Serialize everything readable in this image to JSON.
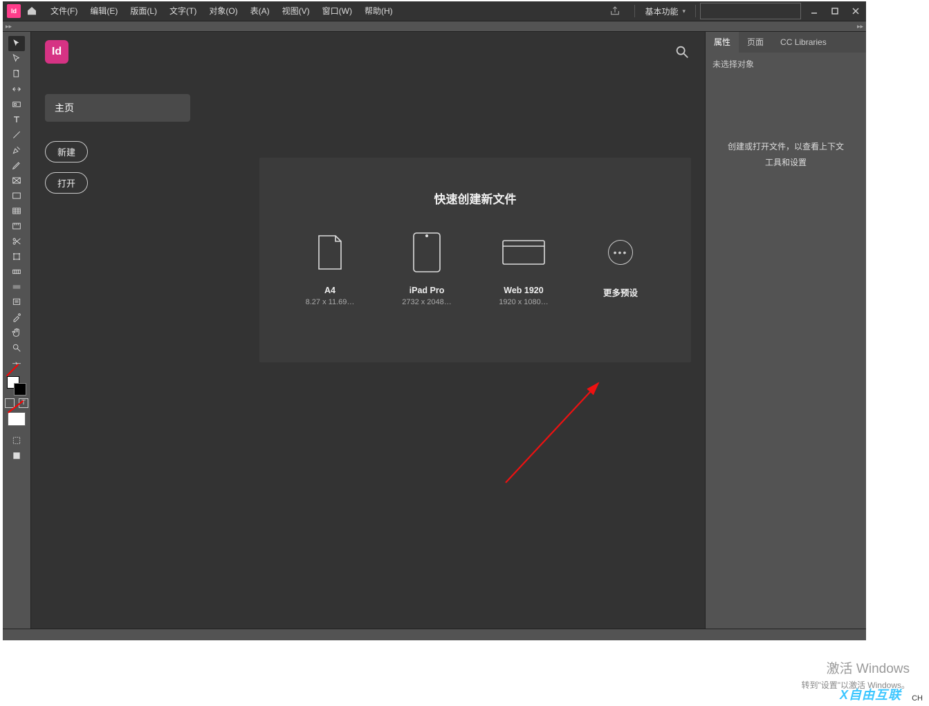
{
  "menu": {
    "items": [
      "文件(F)",
      "编辑(E)",
      "版面(L)",
      "文字(T)",
      "对象(O)",
      "表(A)",
      "视图(V)",
      "窗口(W)",
      "帮助(H)"
    ]
  },
  "workspace_label": "基本功能",
  "left_nav": {
    "home": "主页",
    "new_btn": "新建",
    "open_btn": "打开"
  },
  "quick": {
    "title": "快速创建新文件",
    "presets": [
      {
        "name": "A4",
        "size": "8.27 x 11.69…"
      },
      {
        "name": "iPad Pro",
        "size": "2732 x 2048…"
      },
      {
        "name": "Web 1920",
        "size": "1920 x 1080…"
      }
    ],
    "more": "更多预设"
  },
  "right": {
    "tabs": [
      "属性",
      "页面",
      "CC Libraries"
    ],
    "body_title": "未选择对象",
    "msg1": "创建或打开文件，以查看上下文",
    "msg2": "工具和设置"
  },
  "activate": "激活 Windows",
  "activate_sub": "转到\"设置\"以激活 Windows。",
  "ime": "CH",
  "watermark": "自由互联"
}
